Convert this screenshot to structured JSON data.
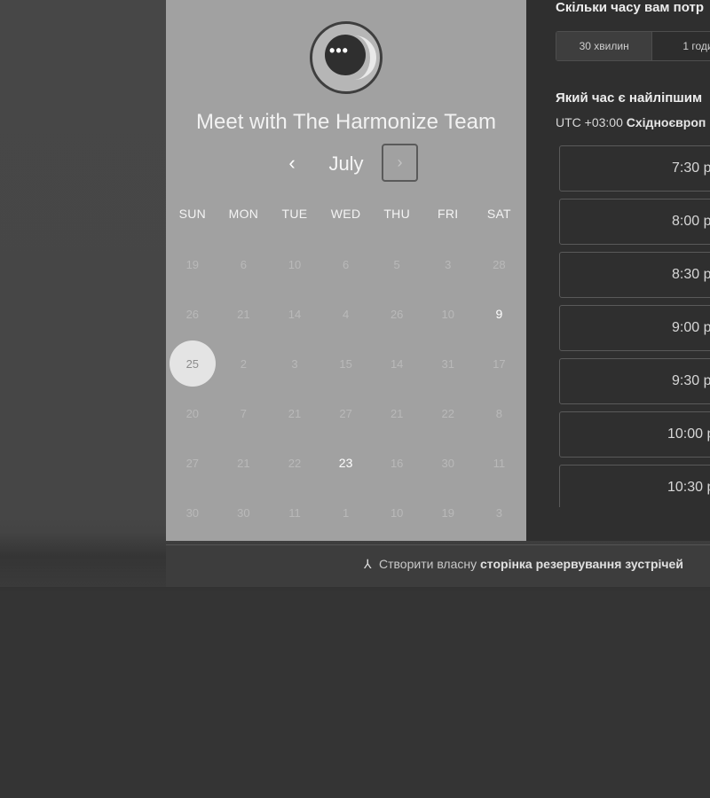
{
  "header": {
    "title": "Meet with The Harmonize Team"
  },
  "calendar": {
    "month": "July",
    "prev_icon": "‹",
    "next_icon": "›",
    "days_of_week": [
      "SUN",
      "MON",
      "TUE",
      "WED",
      "THU",
      "FRI",
      "SAT"
    ],
    "weeks": [
      [
        "19",
        "6",
        "10",
        "6",
        "5",
        "3",
        "28"
      ],
      [
        "26",
        "21",
        "14",
        "4",
        "26",
        "10",
        "9"
      ],
      [
        "25",
        "2",
        "3",
        "15",
        "14",
        "31",
        "17"
      ],
      [
        "20",
        "7",
        "21",
        "27",
        "21",
        "22",
        "8"
      ],
      [
        "27",
        "21",
        "22",
        "23",
        "16",
        "30",
        "11"
      ],
      [
        "30",
        "30",
        "11",
        "1",
        "10",
        "19",
        "3"
      ]
    ],
    "available_days": [
      "9",
      "23"
    ],
    "selected_day": "25"
  },
  "right": {
    "duration_question": "Скільки часу вам потр",
    "durations": [
      "30 хвилин",
      "1 годи"
    ],
    "time_question": "Який час є найліпшим",
    "timezone_prefix": "UTC +03:00 ",
    "timezone_name": "Східноєвроп",
    "time_slots": [
      "7:30 p",
      "8:00 p",
      "8:30 p",
      "9:00 p",
      "9:30 p",
      "10:00 p",
      "10:30 p"
    ]
  },
  "footer": {
    "text_plain": "Створити власну ",
    "text_bold": "сторінка резервування зустрічей"
  },
  "colors": {
    "left_panel_bg": "#a1a1a1",
    "right_panel_bg": "#2f2f2f",
    "page_bg": "#474747"
  }
}
